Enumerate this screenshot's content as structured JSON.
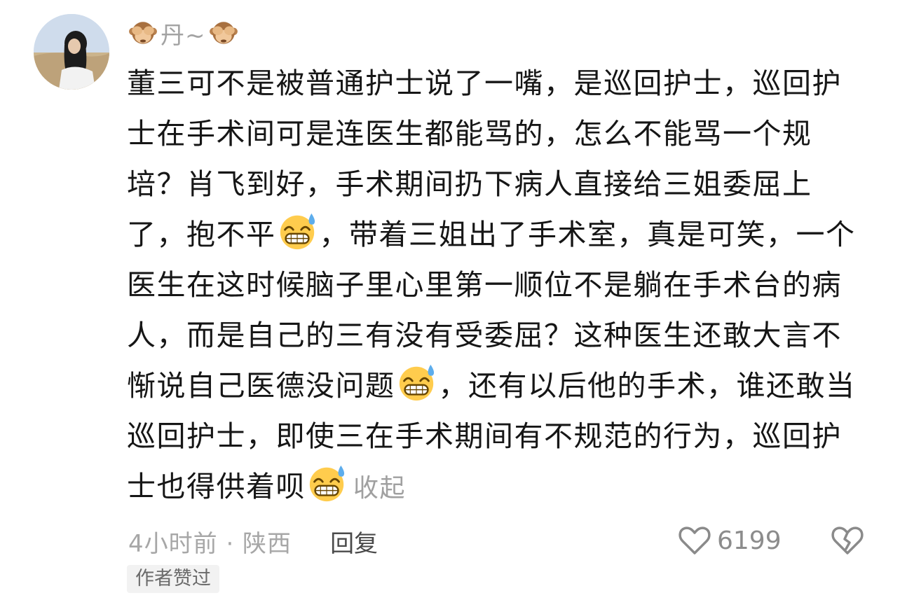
{
  "user": {
    "name": "丹~",
    "avatar_icon": "user-avatar",
    "name_prefix_icon": "see-no-evil-monkey-icon",
    "name_suffix_icon": "see-no-evil-monkey-icon"
  },
  "comment": {
    "seg1": "董三可不是被普通护士说了一嘴，是巡回护士，巡回护士在手术间可是连医生都能骂的，怎么不能骂一个规培？肖飞到好，手术期间扔下病人直接给三姐委屈上了，抱不平",
    "seg2": "，带着三姐出了手术室，真是可笑，一个医生在这时候脑子里心里第一顺位不是躺在手术台的病人，而是自己的三有没有受委屈？这种医生还敢大言不惭说自己医德没问题",
    "seg3": "，还有以后他的手术，谁还敢当巡回护士，即使三在手术期间有不规范的行为，巡回护士也得供着呗",
    "emoji_icon": "grinning-sweat-emoji-icon",
    "collapse_label": "收起"
  },
  "meta": {
    "time_location": "4小时前 · 陕西",
    "reply_label": "回复",
    "like_count": "6199",
    "like_icon": "heart-icon",
    "dislike_icon": "broken-heart-icon"
  },
  "badge": {
    "label": "作者赞过"
  }
}
